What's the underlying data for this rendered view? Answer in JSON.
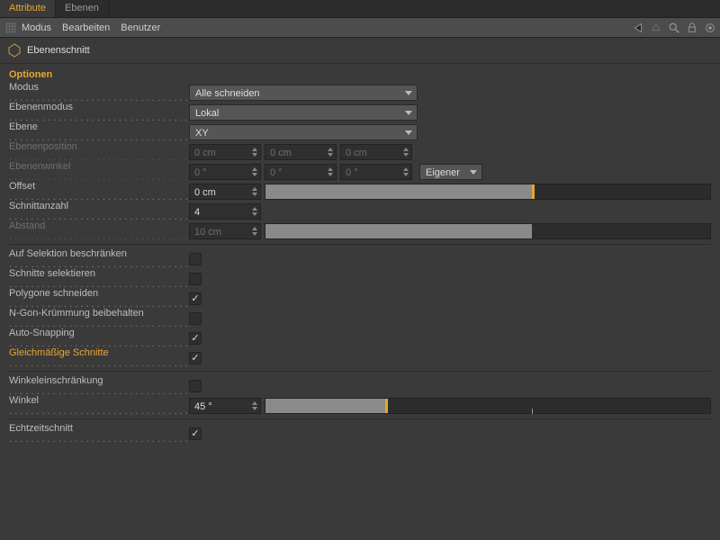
{
  "tabs": {
    "attribute": "Attribute",
    "ebenen": "Ebenen"
  },
  "menu": {
    "modus": "Modus",
    "bearbeiten": "Bearbeiten",
    "benutzer": "Benutzer"
  },
  "tool": {
    "name": "Ebenenschnitt"
  },
  "section": "Optionen",
  "labels": {
    "modus": "Modus",
    "ebenenmodus": "Ebenenmodus",
    "ebene": "Ebene",
    "ebenenposition": "Ebenenposition",
    "ebenenwinkel": "Ebenenwinkel",
    "offset": "Offset",
    "schnittanzahl": "Schnittanzahl",
    "abstand": "Abstand",
    "aufSelektion": "Auf Selektion beschränken",
    "schnitteSelektieren": "Schnitte selektieren",
    "polygoneSchneiden": "Polygone schneiden",
    "ngon": "N-Gon-Krümmung beibehalten",
    "autoSnapping": "Auto-Snapping",
    "gleichmaessig": "Gleichmäßige Schnitte",
    "winkeleinschraenkung": "Winkeleinschränkung",
    "winkel": "Winkel",
    "echtzeit": "Echtzeitschnitt"
  },
  "values": {
    "modus": "Alle schneiden",
    "ebenenmodus": "Lokal",
    "ebene": "XY",
    "pos_x": "0 cm",
    "pos_y": "0 cm",
    "pos_z": "0 cm",
    "ang_x": "0 °",
    "ang_y": "0 °",
    "ang_z": "0 °",
    "angOrder": "Eigener",
    "offset": "0 cm",
    "schnittanzahl": "4",
    "abstand": "10 cm",
    "winkel": "45 °"
  },
  "checks": {
    "aufSelektion": false,
    "schnitteSelektieren": false,
    "polygoneSchneiden": true,
    "ngon": false,
    "autoSnapping": true,
    "gleichmaessig": true,
    "winkeleinschraenkung": false,
    "echtzeit": true
  }
}
